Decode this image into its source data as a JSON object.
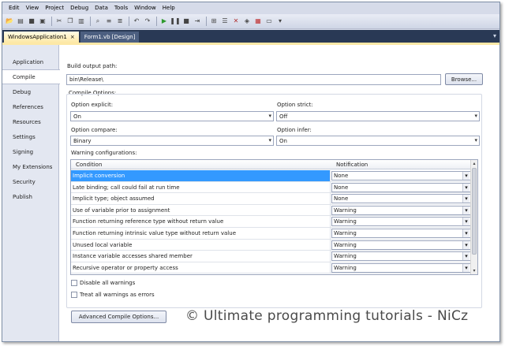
{
  "menu": [
    "Edit",
    "View",
    "Project",
    "Debug",
    "Data",
    "Tools",
    "Window",
    "Help"
  ],
  "toolbar_icons": [
    "open-icon",
    "new-item-icon",
    "save-icon",
    "save-all-icon",
    "cut-icon",
    "copy-icon",
    "paste-icon",
    "find-icon",
    "comment-icon",
    "uncomment-icon",
    "undo-icon",
    "redo-icon",
    "start-debug-icon",
    "pause-icon",
    "stop-icon",
    "step-icon",
    "solution-explorer-icon",
    "properties-icon",
    "toolbox-icon",
    "object-browser-icon",
    "start-page-icon",
    "window-icon"
  ],
  "doc_tabs": [
    {
      "label": "WindowsApplication1",
      "active": true,
      "close": "×"
    },
    {
      "label": "Form1.vb [Design]",
      "active": false,
      "close": ""
    }
  ],
  "side_tabs": [
    "Application",
    "Compile",
    "Debug",
    "References",
    "Resources",
    "Settings",
    "Signing",
    "My Extensions",
    "Security",
    "Publish"
  ],
  "active_side_tab": "Compile",
  "compile": {
    "build_output_label": "Build output path:",
    "build_output_value": "bin\\Release\\",
    "browse_label": "Browse...",
    "compile_options_label": "Compile Options:",
    "option_explicit_label": "Option explicit:",
    "option_explicit_value": "On",
    "option_strict_label": "Option strict:",
    "option_strict_value": "Off",
    "option_compare_label": "Option compare:",
    "option_compare_value": "Binary",
    "option_infer_label": "Option infer:",
    "option_infer_value": "On",
    "warning_config_label": "Warning configurations:",
    "grid_headers": {
      "condition": "Condition",
      "notification": "Notification"
    },
    "warnings": [
      {
        "condition": "Implicit conversion",
        "notification": "None"
      },
      {
        "condition": "Late binding; call could fail at run time",
        "notification": "None"
      },
      {
        "condition": "Implicit type; object assumed",
        "notification": "None"
      },
      {
        "condition": "Use of variable prior to assignment",
        "notification": "Warning"
      },
      {
        "condition": "Function returning reference type without return value",
        "notification": "Warning"
      },
      {
        "condition": "Function returning intrinsic value type without return value",
        "notification": "Warning"
      },
      {
        "condition": "Unused local variable",
        "notification": "Warning"
      },
      {
        "condition": "Instance variable accesses shared member",
        "notification": "Warning"
      },
      {
        "condition": "Recursive operator or property access",
        "notification": "Warning"
      }
    ],
    "selected_warning_index": 0,
    "disable_all_warnings_label": "Disable all warnings",
    "treat_warnings_as_errors_label": "Treat all warnings as errors",
    "advanced_button_label": "Advanced Compile Options..."
  },
  "watermark": "© Ultimate programming tutorials - NiCz",
  "colors": {
    "selection": "#3399ff",
    "tab_strip": "#293955",
    "active_tab": "#fde8a6"
  }
}
